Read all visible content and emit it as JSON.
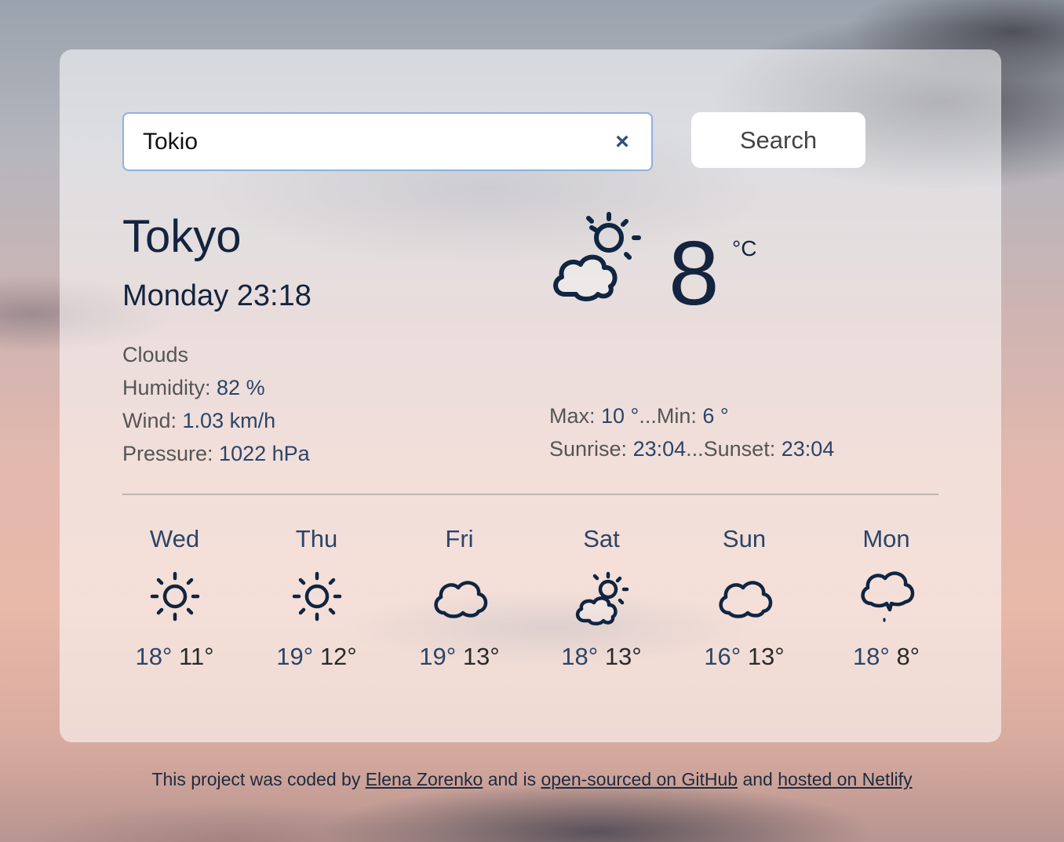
{
  "search": {
    "value": "Tokio",
    "clear_icon": "close-icon",
    "button_label": "Search"
  },
  "current": {
    "city": "Tokyo",
    "datetime": "Monday 23:18",
    "description": "Clouds",
    "humidity_label": "Humidity: ",
    "humidity_value": "82 %",
    "wind_label": "Wind: ",
    "wind_value": "1.03 km/h",
    "pressure_label": "Pressure: ",
    "pressure_value": "1022 hPa",
    "icon": "partly-cloudy-icon",
    "temperature": "8",
    "unit": "°C",
    "max_label": "Max: ",
    "max_value": "10 °",
    "min_label": "...Min: ",
    "min_value": "6 °",
    "sunrise_label": "Sunrise: ",
    "sunrise_value": "23:04",
    "sunset_label": "...Sunset: ",
    "sunset_value": "23:04"
  },
  "forecast": [
    {
      "day": "Wed",
      "icon": "sun-icon",
      "max": "18°",
      "min": "11°"
    },
    {
      "day": "Thu",
      "icon": "sun-icon",
      "max": "19°",
      "min": "12°"
    },
    {
      "day": "Fri",
      "icon": "cloud-icon",
      "max": "19°",
      "min": "13°"
    },
    {
      "day": "Sat",
      "icon": "partly-cloudy-icon",
      "max": "18°",
      "min": "13°"
    },
    {
      "day": "Sun",
      "icon": "cloud-icon",
      "max": "16°",
      "min": "13°"
    },
    {
      "day": "Mon",
      "icon": "rain-cloud-icon",
      "max": "18°",
      "min": "8°"
    }
  ],
  "footer": {
    "text1": "This project was coded by ",
    "author_link": "Elena Zorenko",
    "text2": " and is ",
    "github_link": "open-sourced on GitHub",
    "text3": " and ",
    "netlify_link": "hosted on Netlify"
  },
  "colors": {
    "accent": "#2b4568",
    "heading": "#14243f",
    "input_border": "#8fb0e0"
  }
}
